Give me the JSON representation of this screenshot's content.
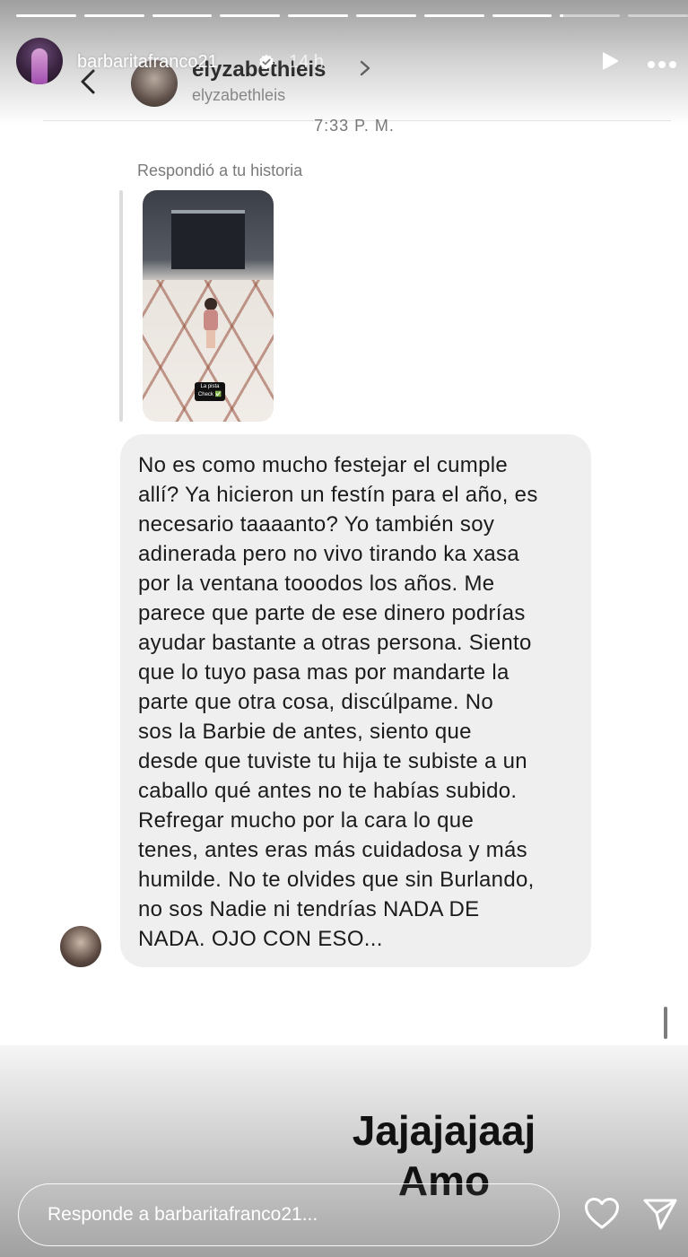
{
  "story": {
    "username": "barbaritafranco21",
    "time_ago": "14 h",
    "progress_segments": 10,
    "current_segment": 9,
    "current_segment_progress": 0.05
  },
  "dm": {
    "name": "elyzabethleis",
    "handle": "elyzabethleis",
    "timestamp": "7:33 P. M.",
    "reply_label": "Respondió a tu historia",
    "story_thumb": {
      "sticker_line1": "La pista",
      "sticker_line2": "Check ✅"
    },
    "message": "No es como mucho festejar el cumple\nallí? Ya hicieron un festín para el año, es\nnecesario taaaanto? Yo también soy\nadinerada pero no vivo tirando ka xasa\npor la ventana tooodos los años. Me\nparece que parte de ese dinero podrías\nayudar bastante a otras persona. Siento\nque lo tuyo pasa mas por mandarte la\nparte que otra cosa, discúlpame. No\nsos la Barbie de antes, siento que\ndesde que tuviste tu hija te subiste a un\ncaballo qué antes no te habías subido.\nRefregar mucho por la cara lo que\ntenes, antes eras más cuidadosa y más\nhumilde. No te olvides que sin Burlando,\nno sos Nadie ni tendrías NADA DE\nNADA. OJO CON ESO..."
  },
  "caption": {
    "line1": "Jajajajaaj",
    "line2": "Amo"
  },
  "reply": {
    "placeholder": "Responde a barbaritafranco21..."
  },
  "icons": {
    "verified": "verified-badge-icon",
    "play": "play-icon",
    "more": "more-icon",
    "heart": "heart-icon",
    "send": "send-icon",
    "back": "back-arrow-icon",
    "chevron": "chevron-right-icon"
  }
}
